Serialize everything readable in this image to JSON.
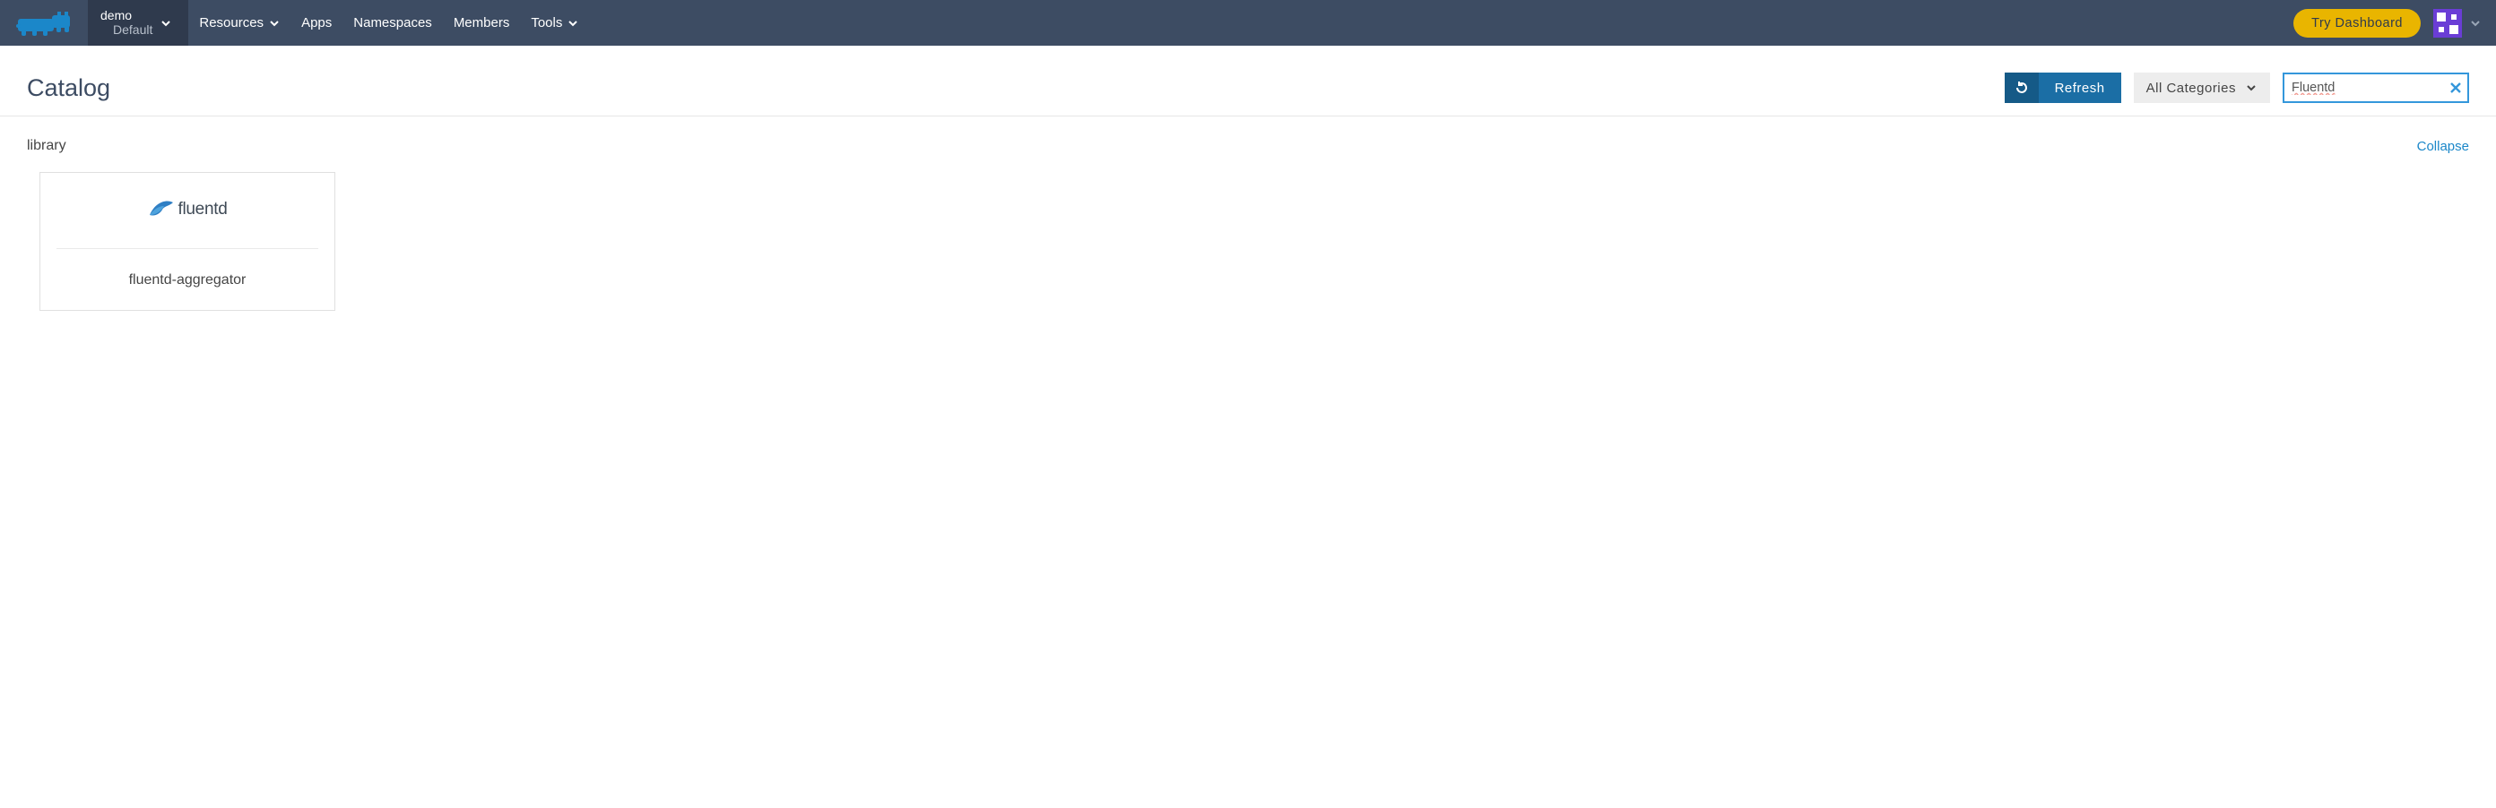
{
  "header": {
    "cluster_name": "demo",
    "env_name": "Default",
    "nav": {
      "resources": "Resources",
      "apps": "Apps",
      "namespaces": "Namespaces",
      "members": "Members",
      "tools": "Tools"
    },
    "try_dashboard": "Try Dashboard"
  },
  "page": {
    "title": "Catalog",
    "refresh_label": "Refresh",
    "category_label": "All Categories",
    "search_value": "Fluentd"
  },
  "section": {
    "title": "library",
    "collapse": "Collapse"
  },
  "cards": [
    {
      "logo_text": "fluentd",
      "name": "fluentd-aggregator"
    }
  ]
}
